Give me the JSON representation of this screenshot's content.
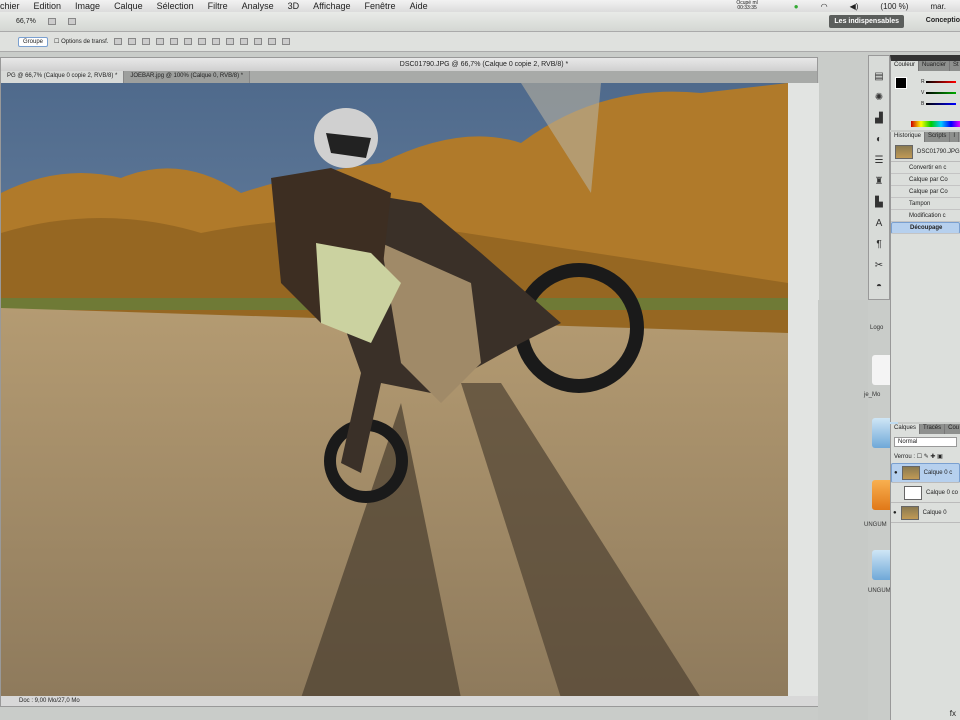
{
  "menubar": {
    "items": [
      "chier",
      "Edition",
      "Image",
      "Calque",
      "Sélection",
      "Filtre",
      "Analyse",
      "3D",
      "Affichage",
      "Fenêtre",
      "Aide"
    ],
    "clock_top": "Ocupé ml",
    "clock_bottom": "00:33:35",
    "battery": "(100 %)",
    "user": "mar."
  },
  "appbar": {
    "zoom": "66,7%",
    "workspace_active": "Les indispensables",
    "workspace_next": "Conceptio"
  },
  "options": {
    "group_label": "Groupe",
    "auto_label": "Options de transf."
  },
  "document": {
    "title": "DSC01790.JPG @ 66,7% (Calque 0 copie 2, RVB/8) *",
    "tabs": [
      "PG @ 66,7% (Calque 0 copie 2, RVB/8) *",
      "JOEBAR.jpg @ 100% (Calque 0, RVB/8) *"
    ],
    "status": "Doc : 9,00 Mo/27,0 Mo"
  },
  "color_panel": {
    "tabs": [
      "Couleur",
      "Nuancier",
      "St"
    ],
    "sliders": [
      "R",
      "V",
      "B"
    ],
    "values": [
      "0",
      "0",
      "0"
    ]
  },
  "history_panel": {
    "tabs": [
      "Historique",
      "Scripts",
      "I"
    ],
    "snapshot": "DSC01790.JPG",
    "items": [
      "Convertir en c",
      "Calque par Co",
      "Calque par Co",
      "Tampon",
      "Modification c",
      "Découpage"
    ]
  },
  "layers_panel": {
    "tabs": [
      "Calques",
      "Tracés",
      "Cou"
    ],
    "blend": "Normal",
    "lock_label": "Verrou :",
    "layers": [
      "Calque 0 c",
      "Calque 0 co",
      "Calque 0"
    ]
  },
  "desktop": {
    "labels": [
      "Logo",
      "je_Mo",
      "UNGUM",
      "UNGUM"
    ]
  }
}
